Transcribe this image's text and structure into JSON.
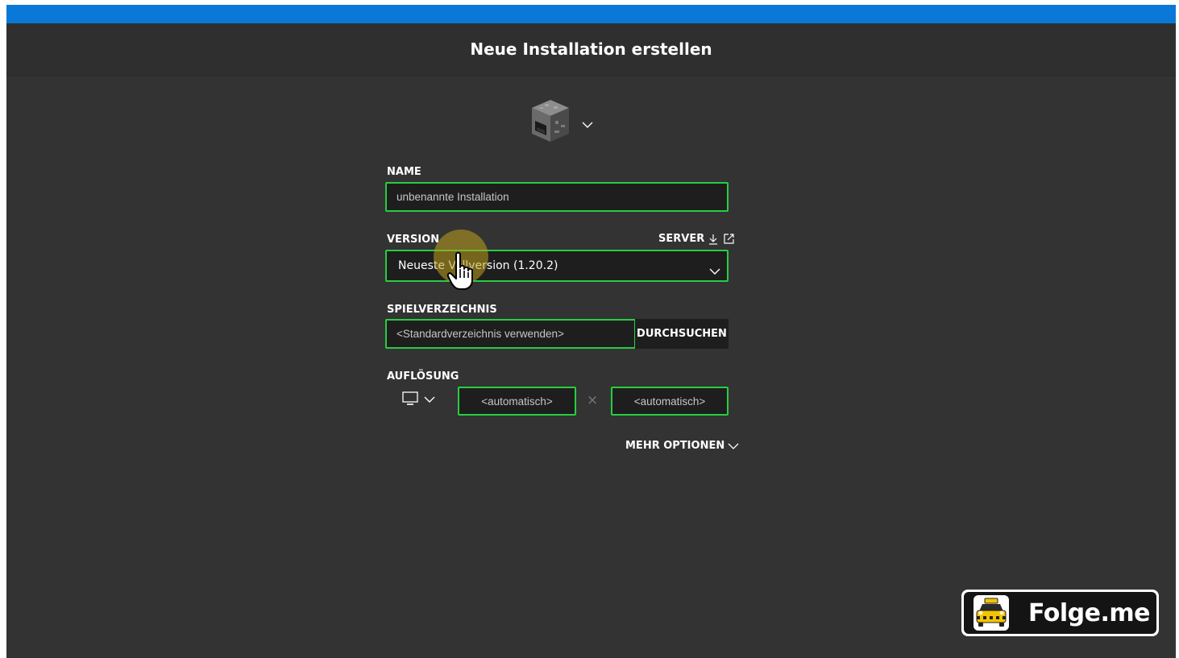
{
  "header": {
    "title": "Neue Installation erstellen"
  },
  "icon_picker": {
    "icon": "furnace-block-icon"
  },
  "name_field": {
    "label": "NAME",
    "value": "unbenannte Installation"
  },
  "version_field": {
    "label": "VERSION",
    "value": "Neueste Vollversion (1.20.2)",
    "server_label": "SERVER"
  },
  "game_dir": {
    "label": "SPIELVERZEICHNIS",
    "placeholder": "<Standardverzeichnis verwenden>",
    "browse_label": "DURCHSUCHEN"
  },
  "resolution": {
    "label": "AUFLÖSUNG",
    "width_placeholder": "<automatisch>",
    "height_placeholder": "<automatisch>",
    "separator": "×"
  },
  "more_options": {
    "label": "MEHR OPTIONEN"
  },
  "watermark": {
    "text": "Folge.me"
  },
  "colors": {
    "accent_bar": "#0a78d7",
    "field_border": "#27ce40",
    "background": "#333333"
  }
}
